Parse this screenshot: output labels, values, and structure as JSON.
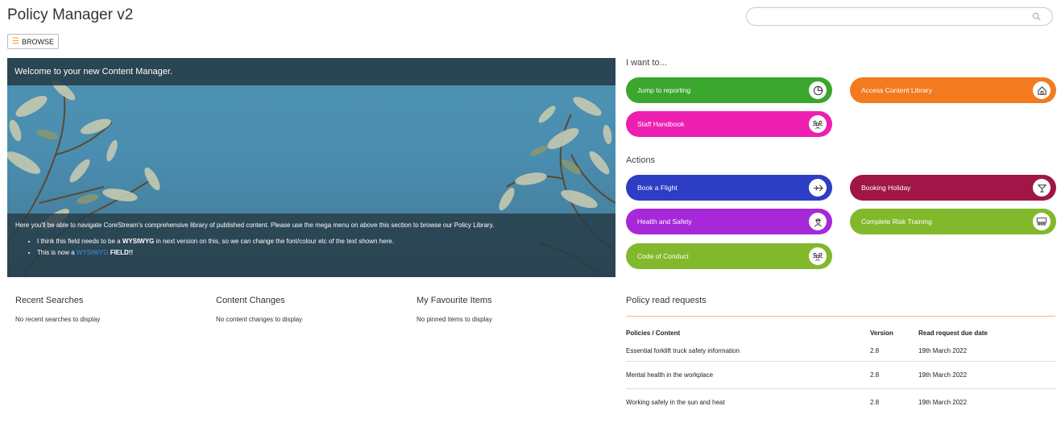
{
  "header": {
    "title": "Policy Manager v2",
    "search_placeholder": "",
    "browse_label": "BROWSE"
  },
  "hero": {
    "title": "Welcome to your new Content Manager.",
    "intro": "Here you'll be able to navigate CoreStream's comprehensive library of published content. Please use the mega menu on above this section to browse our Policy Library.",
    "bullet1_pre": "I think this field needs to be a ",
    "bullet1_bold": "WYSIWYG",
    "bullet1_post": " in next version on this, so we can change the font/colour etc of the text shown here.",
    "bullet2_pre": "This is now a ",
    "bullet2_blue": "WYSIWYG",
    "bullet2_bold": " FIELD!!"
  },
  "i_want_to": {
    "label": "I want to...",
    "items": [
      {
        "label": "Jump to reporting",
        "color": "#3aa62e",
        "icon": "chart-icon"
      },
      {
        "label": "Access Content Library",
        "color": "#f37a1f",
        "icon": "home-icon"
      },
      {
        "label": "Staff Handbook",
        "color": "#ec1fb0",
        "icon": "people-icon"
      }
    ]
  },
  "actions": {
    "label": "Actions",
    "items": [
      {
        "label": "Book a Flight",
        "color": "#2d3ec4",
        "icon": "plane-icon"
      },
      {
        "label": "Booking Holiday",
        "color": "#a01646",
        "icon": "cocktail-icon"
      },
      {
        "label": "Health and Safety",
        "color": "#a628d8",
        "icon": "worker-icon"
      },
      {
        "label": "Complete Risk Training",
        "color": "#82b92c",
        "icon": "training-icon"
      },
      {
        "label": "Code of Conduct",
        "color": "#82b92c",
        "icon": "people-icon"
      }
    ]
  },
  "recent_searches": {
    "title": "Recent Searches",
    "message": "No recent searches to display"
  },
  "content_changes": {
    "title": "Content Changes",
    "message": "No content changes to display"
  },
  "favourites": {
    "title": "My Favourite Items",
    "message": "No pinned items to display"
  },
  "policy_read_requests": {
    "title": "Policy read requests",
    "columns": [
      "Policies / Content",
      "Version",
      "Read request due date"
    ],
    "rows": [
      {
        "policy": "Essential forklift truck safety information",
        "version": "2.8",
        "due": "19th March 2022"
      },
      {
        "policy": "Mental health in the workplace",
        "version": "2.8",
        "due": "19th March 2022"
      },
      {
        "policy": "Working safely in the sun and heat",
        "version": "2.8",
        "due": "19th March 2022"
      }
    ]
  }
}
